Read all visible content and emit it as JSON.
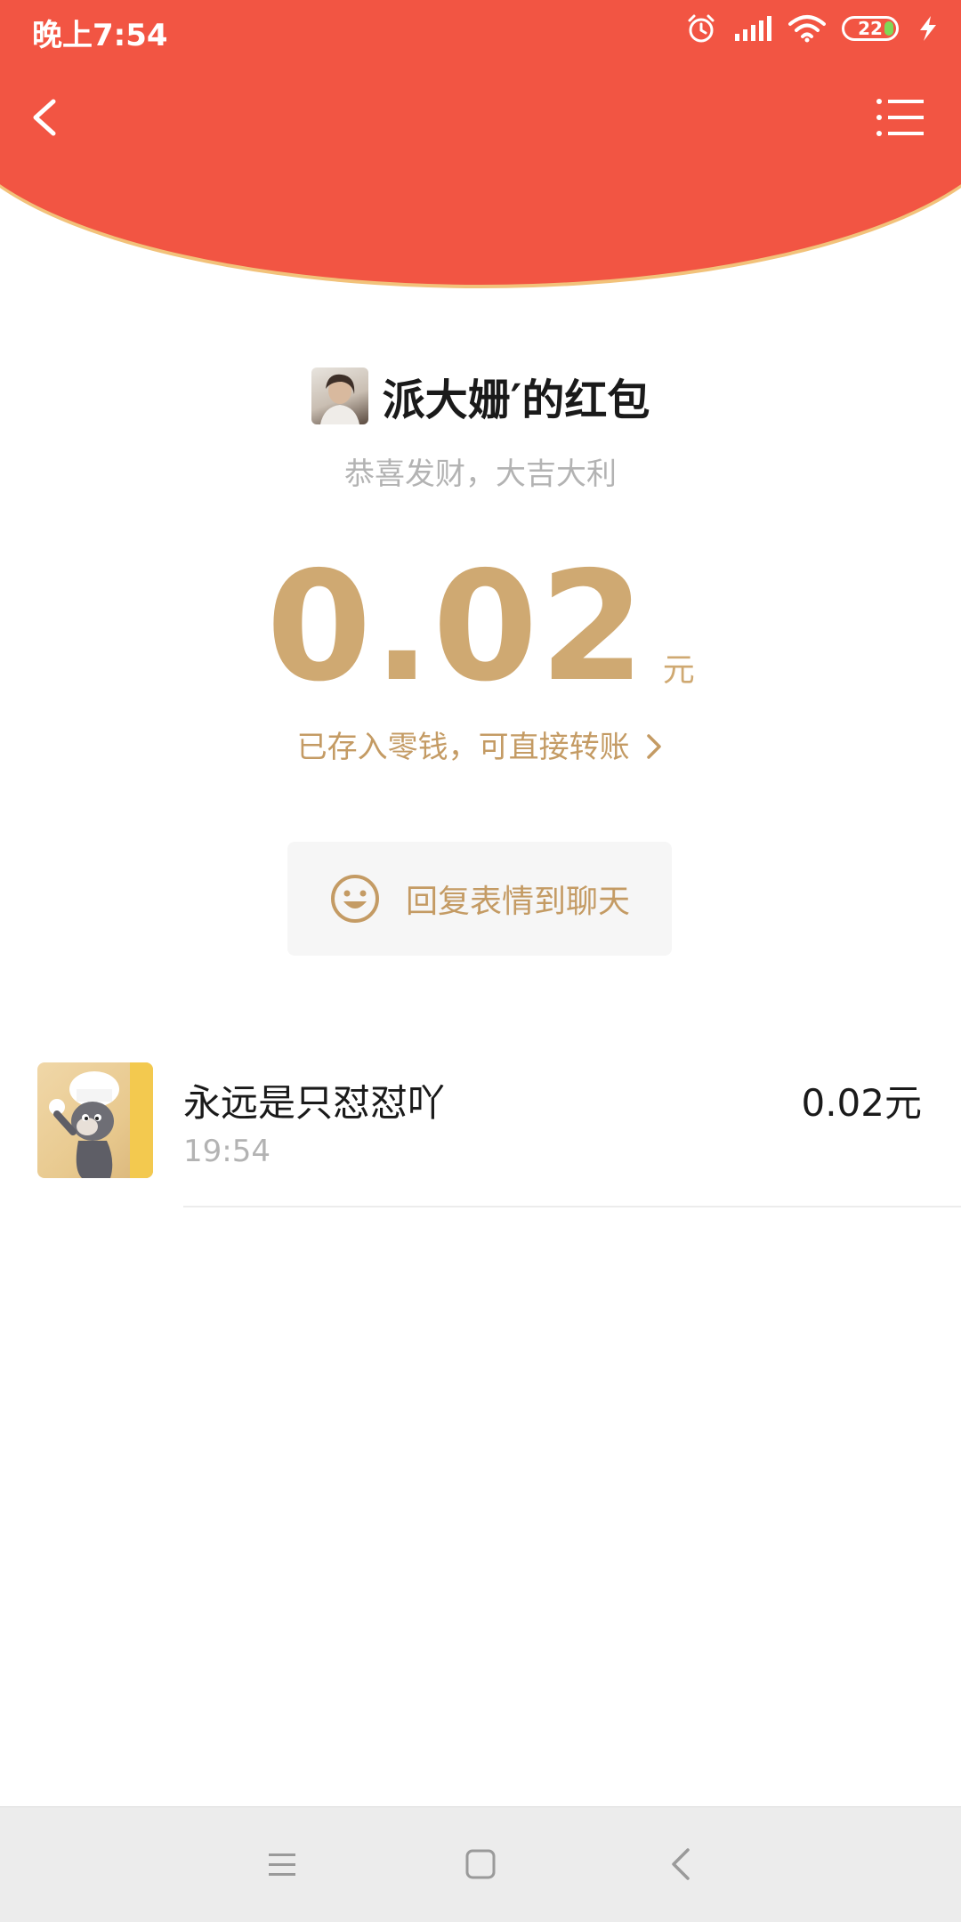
{
  "status_bar": {
    "time": "晚上7:54",
    "battery_level": "22"
  },
  "header": {
    "back_icon": "chevron-left-icon",
    "menu_icon": "list-menu-icon",
    "colors": {
      "header_red": "#f25543",
      "accent_gold": "#cfa972"
    }
  },
  "packet": {
    "sender_title": "派大姗′的红包",
    "greeting": "恭喜发财，大吉大利",
    "amount": "0.02",
    "unit": "元",
    "deposit_note": "已存入零钱，可直接转账"
  },
  "reply": {
    "label": "回复表情到聊天",
    "icon": "smiley-icon"
  },
  "recipients": [
    {
      "name": "永远是只怼怼吖",
      "time": "19:54",
      "amount": "0.02元"
    }
  ],
  "system_nav": {
    "menu_icon": "menu-icon",
    "home_icon": "home-square-icon",
    "back_icon": "back-icon"
  }
}
